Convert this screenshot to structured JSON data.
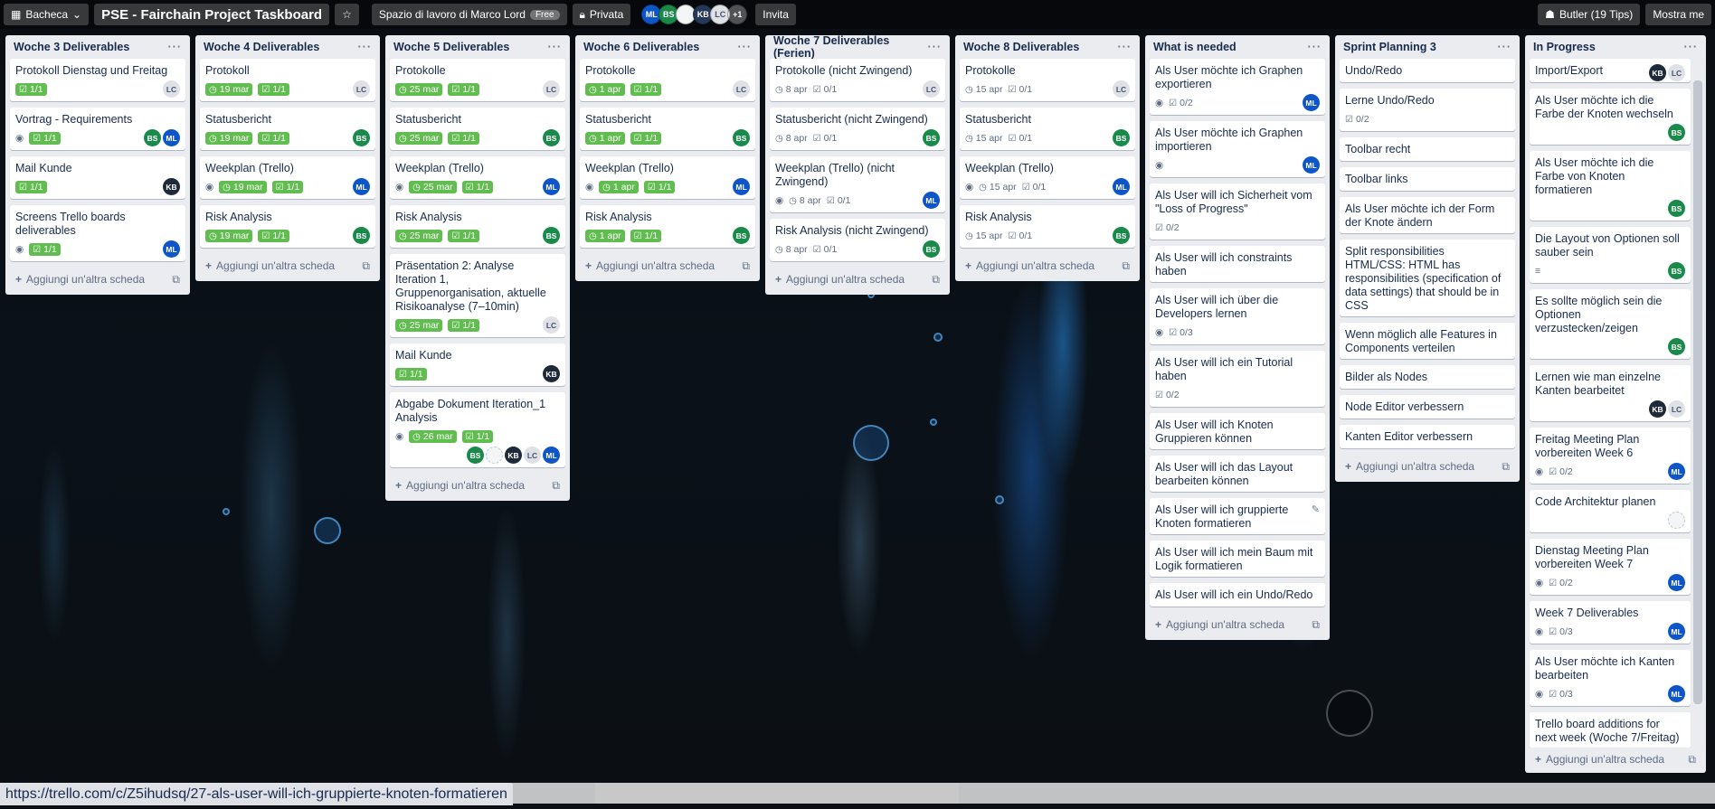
{
  "header": {
    "boards_label": "Bacheca",
    "board_title": "PSE - Fairchain Project Taskboard",
    "workspace": "Spazio di lavoro di Marco Lord",
    "free": "Free",
    "visibility": "Privata",
    "members": [
      "ML",
      "BS",
      "",
      "KB",
      "LC"
    ],
    "more_members": "+1",
    "invite": "Invita",
    "butler": "Butler (19 Tips)",
    "show_menu": "Mostra me"
  },
  "add_card_label": "Aggiungi un'altra scheda",
  "lists": [
    {
      "title": "Woche 3 Deliverables",
      "cards": [
        {
          "title": "Protokoll Dienstag und Freitag",
          "checklist": "1/1",
          "members": [
            "LC"
          ]
        },
        {
          "title": "Vortrag - Requirements",
          "watch": true,
          "checklist": "1/1",
          "members": [
            "BS",
            "ML"
          ]
        },
        {
          "title": "Mail Kunde",
          "checklist": "1/1",
          "members": [
            "KB"
          ]
        },
        {
          "title": "Screens Trello boards deliverables",
          "watch": true,
          "checklist": "1/1",
          "members": [
            "ML"
          ]
        }
      ]
    },
    {
      "title": "Woche 4 Deliverables",
      "cards": [
        {
          "title": "Protokoll",
          "due": "19 mar",
          "checklist": "1/1",
          "members": [
            "LC"
          ]
        },
        {
          "title": "Statusbericht",
          "due": "19 mar",
          "checklist": "1/1",
          "members": [
            "BS"
          ]
        },
        {
          "title": "Weekplan (Trello)",
          "watch": true,
          "due": "19 mar",
          "checklist": "1/1",
          "members": [
            "ML"
          ]
        },
        {
          "title": "Risk Analysis",
          "due": "19 mar",
          "checklist": "1/1",
          "members": [
            "BS"
          ]
        }
      ]
    },
    {
      "title": "Woche 5 Deliverables",
      "cards": [
        {
          "title": "Protokolle",
          "due": "25 mar",
          "checklist": "1/1",
          "members": [
            "LC"
          ]
        },
        {
          "title": "Statusbericht",
          "due": "25 mar",
          "checklist": "1/1",
          "members": [
            "BS"
          ]
        },
        {
          "title": "Weekplan (Trello)",
          "watch": true,
          "due": "25 mar",
          "checklist": "1/1",
          "members": [
            "ML"
          ]
        },
        {
          "title": "Risk Analysis",
          "due": "25 mar",
          "checklist": "1/1",
          "members": [
            "BS"
          ]
        },
        {
          "title": "Präsentation 2: Analyse Iteration 1, Gruppenorganisation, aktuelle Risikoanalyse (7–10min)",
          "due": "25 mar",
          "checklist": "1/1",
          "members": [
            "LC"
          ]
        },
        {
          "title": "Mail Kunde",
          "checklist": "1/1",
          "members": [
            "KB"
          ]
        },
        {
          "title": "Abgabe Dokument Iteration_1 Analysis",
          "watch": true,
          "due": "26 mar",
          "checklist": "1/1",
          "members": [
            "BS",
            "",
            "KB",
            "LC",
            "ML"
          ],
          "avatars_below": true
        }
      ]
    },
    {
      "title": "Woche 6 Deliverables",
      "cards": [
        {
          "title": "Protokolle",
          "due": "1 apr",
          "checklist": "1/1",
          "members": [
            "LC"
          ]
        },
        {
          "title": "Statusbericht",
          "due": "1 apr",
          "checklist": "1/1",
          "members": [
            "BS"
          ]
        },
        {
          "title": "Weekplan (Trello)",
          "watch": true,
          "due": "1 apr",
          "checklist": "1/1",
          "members": [
            "ML"
          ]
        },
        {
          "title": "Risk Analysis",
          "due": "1 apr",
          "checklist": "1/1",
          "members": [
            "BS"
          ]
        }
      ]
    },
    {
      "title": "Woche 7 Deliverables (Ferien)",
      "cards": [
        {
          "title": "Protokolle (nicht Zwingend)",
          "due_plain": "8 apr",
          "checklist_plain": "0/1",
          "members": [
            "LC"
          ]
        },
        {
          "title": "Statusbericht (nicht Zwingend)",
          "due_plain": "8 apr",
          "checklist_plain": "0/1",
          "members": [
            "BS"
          ]
        },
        {
          "title": "Weekplan (Trello) (nicht Zwingend)",
          "watch": true,
          "due_plain": "8 apr",
          "checklist_plain": "0/1",
          "members": [
            "ML"
          ]
        },
        {
          "title": "Risk Analysis (nicht Zwingend)",
          "due_plain": "8 apr",
          "checklist_plain": "0/1",
          "members": [
            "BS"
          ]
        }
      ]
    },
    {
      "title": "Woche 8 Deliverables",
      "cards": [
        {
          "title": "Protokolle",
          "due_plain": "15 apr",
          "checklist_plain": "0/1",
          "members": [
            "LC"
          ]
        },
        {
          "title": "Statusbericht",
          "due_plain": "15 apr",
          "checklist_plain": "0/1",
          "members": [
            "BS"
          ]
        },
        {
          "title": "Weekplan (Trello)",
          "watch": true,
          "due_plain": "15 apr",
          "checklist_plain": "0/1",
          "members": [
            "ML"
          ]
        },
        {
          "title": "Risk Analysis",
          "due_plain": "15 apr",
          "checklist_plain": "0/1",
          "members": [
            "BS"
          ]
        }
      ]
    },
    {
      "title": "What is needed",
      "cards": [
        {
          "title": "Als User möchte ich Graphen exportieren",
          "watch": true,
          "checklist_plain": "0/2",
          "members": [
            "ML"
          ]
        },
        {
          "title": "Als User möchte ich Graphen importieren",
          "watch": true,
          "members": [
            "ML"
          ]
        },
        {
          "title": "Als User will ich Sicherheit vom \"Loss of Progress\"",
          "checklist_plain": "0/2",
          "members": []
        },
        {
          "title": "Als User will ich constraints haben",
          "members": []
        },
        {
          "title": "Als User will ich über die Developers lernen",
          "watch": true,
          "checklist_plain": "0/3",
          "members": []
        },
        {
          "title": "Als User will ich ein Tutorial haben",
          "checklist_plain": "0/2",
          "members": []
        },
        {
          "title": "Als User will ich Knoten Gruppieren können",
          "members": []
        },
        {
          "title": "Als User will ich das Layout bearbeiten können",
          "members": []
        },
        {
          "title": "Als User will ich gruppierte Knoten formatieren",
          "members": [],
          "edit": true
        },
        {
          "title": "Als User will ich mein Baum mit Logik formatieren",
          "members": []
        },
        {
          "title": "Als User will ich ein Undo/Redo",
          "members": []
        }
      ]
    },
    {
      "title": "Sprint Planning 3",
      "cards": [
        {
          "title": "Undo/Redo",
          "members": []
        },
        {
          "title": "Lerne Undo/Redo",
          "checklist_plain": "0/2",
          "members": []
        },
        {
          "title": "Toolbar recht",
          "members": []
        },
        {
          "title": "Toolbar links",
          "members": []
        },
        {
          "title": "Als User möchte ich der Form der Knote ändern",
          "members": []
        },
        {
          "title": "Split responsibilities HTML/CSS: HTML has responsibilities (specification of data settings) that should be in CSS",
          "members": []
        },
        {
          "title": "Wenn möglich alle Features in Components verteilen",
          "members": []
        },
        {
          "title": "Bilder als Nodes",
          "members": []
        },
        {
          "title": "Node Editor verbessern",
          "members": []
        },
        {
          "title": "Kanten Editor verbessern",
          "members": []
        }
      ]
    },
    {
      "title": "In Progress",
      "cards": [
        {
          "title": "Import/Export",
          "members": [
            "KB",
            "LC"
          ],
          "inline_avatars": true
        },
        {
          "title": "Als User möchte ich die Farbe der Knoten wechseln",
          "members": [
            "BS"
          ]
        },
        {
          "title": "Als User möchte ich die Farbe von Knoten formatieren",
          "members": [
            "BS"
          ]
        },
        {
          "title": "Die Layout von Optionen soll sauber sein",
          "description": true,
          "members": [
            "BS"
          ]
        },
        {
          "title": "Es sollte möglich sein die Optionen verzustecken/zeigen",
          "members": [
            "BS"
          ]
        },
        {
          "title": "Lernen wie man einzelne Kanten bearbeitet",
          "members": [
            "KB",
            "LC"
          ]
        },
        {
          "title": "Freitag Meeting Plan vorbereiten Week 6",
          "watch": true,
          "checklist_plain": "0/2",
          "members": [
            "ML"
          ]
        },
        {
          "title": "Code Architektur planen",
          "members": [
            ""
          ]
        },
        {
          "title": "Dienstag Meeting Plan vorbereiten Week 7",
          "watch": true,
          "checklist_plain": "0/2",
          "members": [
            "ML"
          ]
        },
        {
          "title": "Week 7 Deliverables",
          "watch": true,
          "checklist_plain": "0/3",
          "members": [
            "ML"
          ]
        },
        {
          "title": "Als User möchte ich Kanten bearbeiten",
          "watch": true,
          "checklist_plain": "0/3",
          "members": [
            "ML"
          ]
        },
        {
          "title": "Trello board additions for next week (Woche 7/Freitag)",
          "members": []
        }
      ]
    }
  ],
  "status_url": "https://trello.com/c/Z5ihudsq/27-als-user-will-ich-gruppierte-knoten-formatieren"
}
